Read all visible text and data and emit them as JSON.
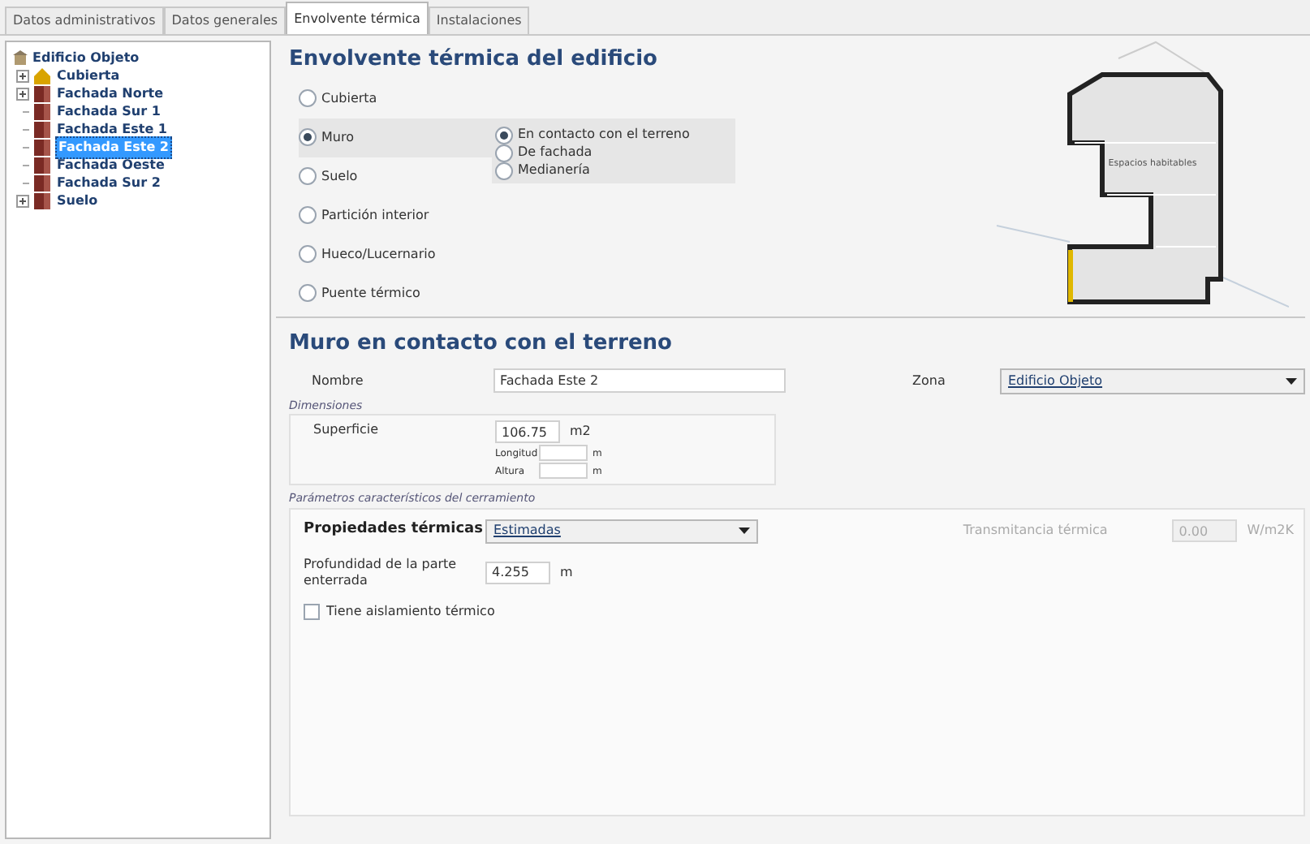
{
  "tabs": [
    {
      "label": "Datos administrativos",
      "selected": false
    },
    {
      "label": "Datos generales",
      "selected": false
    },
    {
      "label": "Envolvente térmica",
      "selected": true
    },
    {
      "label": "Instalaciones",
      "selected": false
    }
  ],
  "tree": {
    "label": "Edificio Objeto",
    "children": [
      {
        "label": "Cubierta",
        "kind": "roof",
        "has_children": true,
        "selected": false
      },
      {
        "label": "Fachada Norte",
        "kind": "wall",
        "has_children": true,
        "selected": false
      },
      {
        "label": "Fachada Sur 1",
        "kind": "wall",
        "has_children": false,
        "selected": false
      },
      {
        "label": "Fachada Este 1",
        "kind": "wall",
        "has_children": false,
        "selected": false
      },
      {
        "label": "Fachada Este 2",
        "kind": "wall",
        "has_children": false,
        "selected": true
      },
      {
        "label": "Fachada Oeste",
        "kind": "wall",
        "has_children": false,
        "selected": false
      },
      {
        "label": "Fachada Sur 2",
        "kind": "wall",
        "has_children": false,
        "selected": false
      },
      {
        "label": "Suelo",
        "kind": "wall",
        "has_children": true,
        "selected": false
      }
    ]
  },
  "envelope": {
    "title": "Envolvente térmica del edificio",
    "types": [
      {
        "label": "Cubierta",
        "selected": false
      },
      {
        "label": "Muro",
        "selected": true
      },
      {
        "label": "Suelo",
        "selected": false
      },
      {
        "label": "Partición interior",
        "selected": false
      },
      {
        "label": "Hueco/Lucernario",
        "selected": false
      },
      {
        "label": "Puente térmico",
        "selected": false
      }
    ],
    "subtypes": [
      {
        "label": "En contacto con el terreno",
        "selected": true
      },
      {
        "label": "De fachada",
        "selected": false
      },
      {
        "label": "Medianería",
        "selected": false
      }
    ],
    "diagram_label": "Espacios habitables"
  },
  "detail": {
    "title": "Muro en contacto con el terreno",
    "name_label": "Nombre",
    "name_value": "Fachada Este 2",
    "zone_label": "Zona",
    "zone_value": "Edificio Objeto",
    "dimensions": {
      "legend": "Dimensiones",
      "area_label": "Superficie",
      "area_value": "106.75",
      "area_unit": "m2",
      "length_label": "Longitud",
      "length_unit": "m",
      "height_label": "Altura",
      "height_unit": "m"
    },
    "params": {
      "legend": "Parámetros característicos del cerramiento",
      "props_label": "Propiedades térmicas",
      "props_value": "Estimadas",
      "u_label": "Transmitancia térmica",
      "u_value": "0.00",
      "u_unit": "W/m2K",
      "u_disabled": true,
      "depth_label": "Profundidad de la parte enterrada",
      "depth_value": "4.255",
      "depth_unit": "m",
      "insulation_label": "Tiene aislamiento térmico",
      "insulation_checked": false
    }
  }
}
